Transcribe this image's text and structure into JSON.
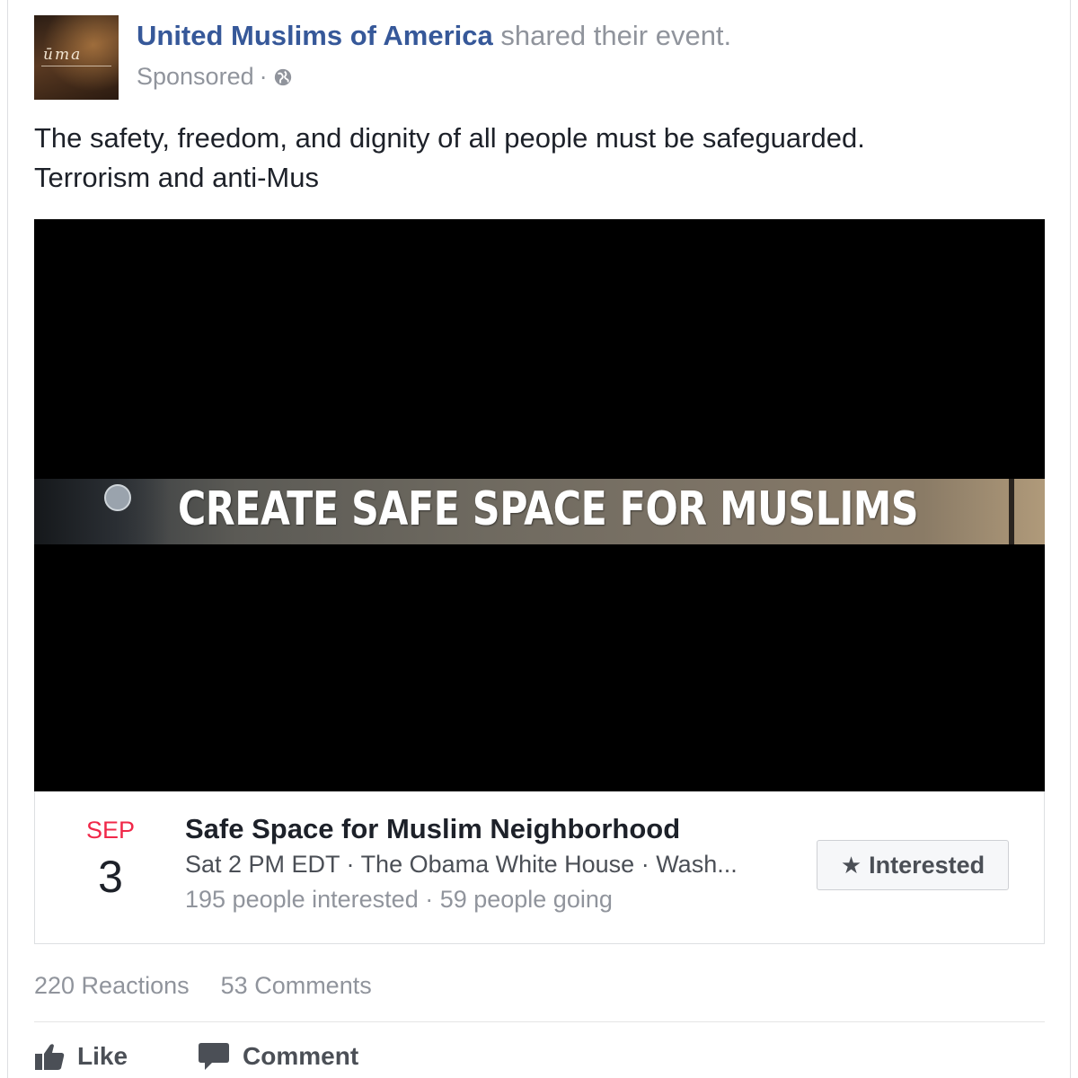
{
  "post": {
    "page_name": "United Muslims of America",
    "shared_text": "shared their event.",
    "sponsored_label": "Sponsored",
    "separator": "·",
    "avatar_text": "ūma",
    "body_line1": "The safety, freedom, and dignity of all people must be safeguarded.",
    "body_line2": "Terrorism and anti-Mus"
  },
  "media": {
    "banner_text": "CREATE SAFE SPACE FOR MUSLIMS"
  },
  "event": {
    "month": "SEP",
    "day": "3",
    "title": "Safe Space for Muslim Neighborhood",
    "details": "Sat 2 PM EDT · The Obama White House · Wash...",
    "stats": "195 people interested · 59 people going",
    "interested_label": "Interested"
  },
  "engagement": {
    "reactions": "220 Reactions",
    "comments": "53 Comments"
  },
  "actions": {
    "like_label": "Like",
    "comment_label": "Comment"
  },
  "colors": {
    "link_blue": "#365899",
    "meta_gray": "#90949c",
    "date_red": "#f02849"
  },
  "icons": {
    "globe": "globe-icon",
    "star": "star-icon",
    "like": "thumbs-up-icon",
    "comment": "speech-bubble-icon"
  }
}
